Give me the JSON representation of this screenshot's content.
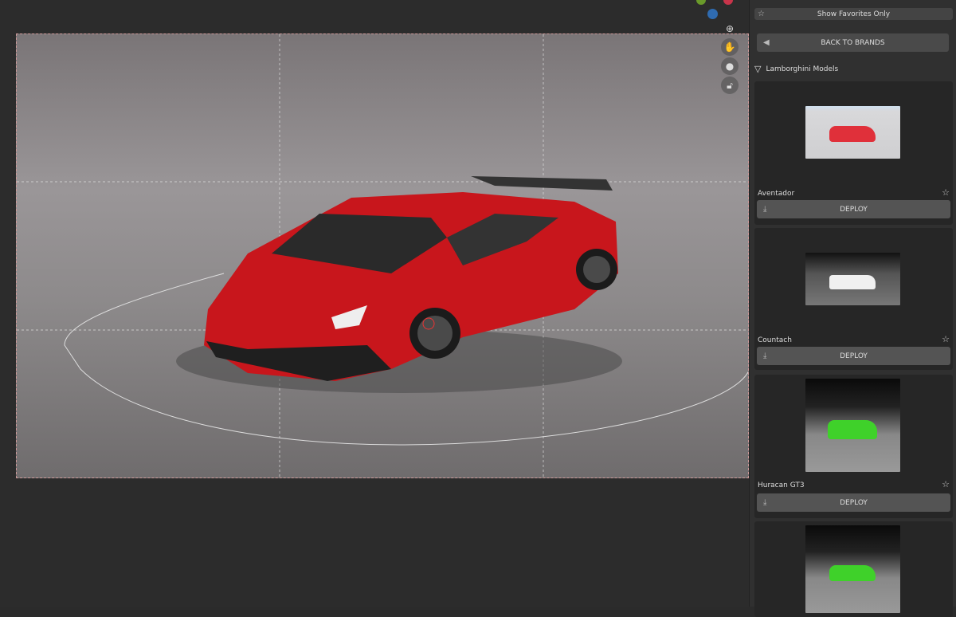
{
  "sidebar": {
    "favorites_label": "Show Favorites Only",
    "back_label": "BACK TO BRANDS",
    "section_title": "Lamborghini Models",
    "models": [
      {
        "name": "Aventador",
        "deploy_label": "DEPLOY",
        "color": "#e0303a"
      },
      {
        "name": "Countach",
        "deploy_label": "DEPLOY",
        "color": "#f0f0f0"
      },
      {
        "name": "Huracan GT3",
        "deploy_label": "DEPLOY",
        "color": "#3fd12a"
      },
      {
        "name": "",
        "deploy_label": "",
        "color": "#3fd12a"
      }
    ]
  },
  "viewport": {
    "nav_icons": [
      "zoom-icon",
      "hand-icon",
      "camera-icon",
      "lock-icon"
    ],
    "car_color": "#c8161c"
  }
}
